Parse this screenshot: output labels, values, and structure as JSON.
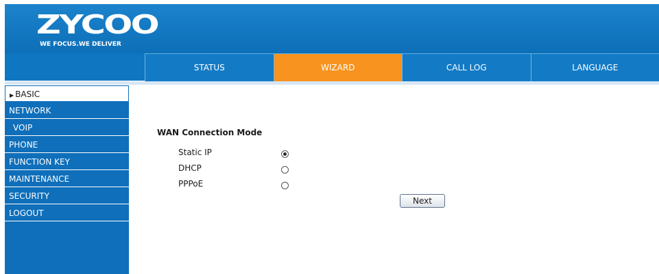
{
  "logo": {
    "mark": "ZYCOO",
    "tagline": "WE FOCUS.WE DELIVER"
  },
  "nav": {
    "tabs": [
      "STATUS",
      "WIZARD",
      "CALL LOG",
      "LANGUAGE"
    ],
    "active": "WIZARD"
  },
  "sidebar": {
    "items": [
      "BASIC",
      "NETWORK",
      "VOIP",
      "PHONE",
      "FUNCTION KEY",
      "MAINTENANCE",
      "SECURITY",
      "LOGOUT"
    ],
    "active": "BASIC"
  },
  "main": {
    "section_title": "WAN Connection Mode",
    "options": [
      "Static IP",
      "DHCP",
      "PPPoE"
    ],
    "selected": "Static IP",
    "next_label": "Next"
  },
  "colors": {
    "header_blue": "#0f76c2",
    "active_tab": "#f7931e",
    "sidebar_blue": "#0f6fba"
  }
}
